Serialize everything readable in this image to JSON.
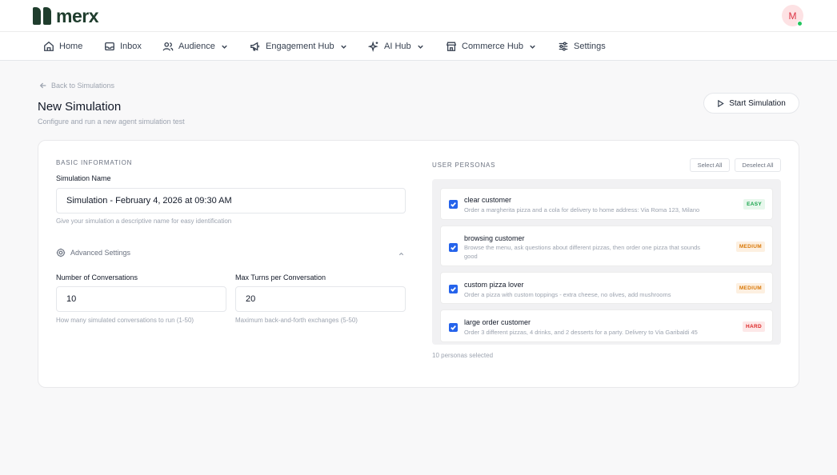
{
  "brand": {
    "name": "merx",
    "color": "#1f3d2d"
  },
  "user": {
    "initial": "M",
    "status_color": "#22c55e"
  },
  "nav": {
    "home": "Home",
    "inbox": "Inbox",
    "audience": "Audience",
    "engagement": "Engagement Hub",
    "ai": "AI Hub",
    "commerce": "Commerce Hub",
    "settings": "Settings"
  },
  "header": {
    "back": "Back to Simulations",
    "title": "New Simulation",
    "subtitle": "Configure and run a new agent simulation test",
    "start_button": "Start Simulation"
  },
  "basic": {
    "section": "BASIC INFORMATION",
    "name_label": "Simulation Name",
    "name_value": "Simulation - February 4, 2026 at 09:30 AM",
    "name_hint": "Give your simulation a descriptive name for easy identification",
    "advanced": "Advanced Settings",
    "conversations_label": "Number of Conversations",
    "conversations_value": "10",
    "conversations_hint": "How many simulated conversations to run (1-50)",
    "turns_label": "Max Turns per Conversation",
    "turns_value": "20",
    "turns_hint": "Maximum back-and-forth exchanges (5-50)"
  },
  "personas": {
    "section": "USER PERSONAS",
    "select_all": "Select All",
    "deselect_all": "Deselect All",
    "selected_count": "10 personas selected",
    "items": [
      {
        "name": "clear customer",
        "desc": "Order a margherita pizza and a cola for delivery to home address: Via Roma 123, Milano",
        "level": "EASY",
        "checked": true
      },
      {
        "name": "browsing customer",
        "desc": "Browse the menu, ask questions about different pizzas, then order one pizza that sounds good",
        "level": "MEDIUM",
        "checked": true
      },
      {
        "name": "custom pizza lover",
        "desc": "Order a pizza with custom toppings - extra cheese, no olives, add mushrooms",
        "level": "MEDIUM",
        "checked": true
      },
      {
        "name": "large order customer",
        "desc": "Order 3 different pizzas, 4 drinks, and 2 desserts for a party. Delivery to Via Garibaldi 45",
        "level": "HARD",
        "checked": true
      }
    ]
  }
}
